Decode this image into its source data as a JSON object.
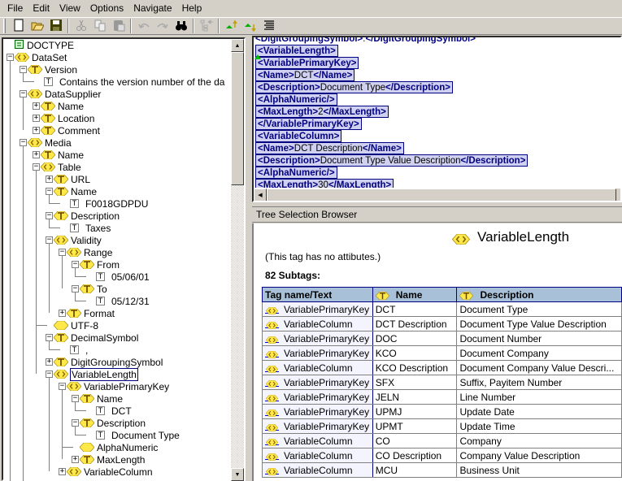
{
  "menu": [
    "File",
    "Edit",
    "View",
    "Options",
    "Navigate",
    "Help"
  ],
  "toolbar": {
    "buttons": [
      {
        "name": "new-icon",
        "enabled": true
      },
      {
        "name": "open-icon",
        "enabled": true
      },
      {
        "name": "save-icon",
        "enabled": true
      },
      {
        "name": "cut-icon",
        "enabled": false
      },
      {
        "name": "copy-icon",
        "enabled": false
      },
      {
        "name": "paste-icon",
        "enabled": false
      },
      {
        "name": "undo-icon",
        "enabled": false
      },
      {
        "name": "redo-icon",
        "enabled": false
      },
      {
        "name": "find-icon",
        "enabled": true
      },
      {
        "name": "tree-back-icon",
        "enabled": false
      },
      {
        "name": "move-up-icon",
        "enabled": true
      },
      {
        "name": "move-down-icon",
        "enabled": true
      },
      {
        "name": "format-icon",
        "enabled": true
      }
    ]
  },
  "tree": [
    {
      "depth": 0,
      "type": "doctype",
      "label": "DOCTYPE",
      "expander": "none"
    },
    {
      "depth": 0,
      "type": "element",
      "label": "DataSet",
      "expander": "minus"
    },
    {
      "depth": 1,
      "type": "text-element",
      "label": "Version",
      "expander": "minus"
    },
    {
      "depth": 2,
      "type": "text",
      "label": "Contains the version number of the da",
      "expander": "none"
    },
    {
      "depth": 1,
      "type": "element",
      "label": "DataSupplier",
      "expander": "minus"
    },
    {
      "depth": 2,
      "type": "text-element",
      "label": "Name",
      "expander": "plus"
    },
    {
      "depth": 2,
      "type": "text-element",
      "label": "Location",
      "expander": "plus"
    },
    {
      "depth": 2,
      "type": "text-element",
      "label": "Comment",
      "expander": "plus"
    },
    {
      "depth": 1,
      "type": "element",
      "label": "Media",
      "expander": "minus"
    },
    {
      "depth": 2,
      "type": "text-element",
      "label": "Name",
      "expander": "plus"
    },
    {
      "depth": 2,
      "type": "element",
      "label": "Table",
      "expander": "minus"
    },
    {
      "depth": 3,
      "type": "text-element",
      "label": "URL",
      "expander": "plus"
    },
    {
      "depth": 3,
      "type": "text-element",
      "label": "Name",
      "expander": "minus"
    },
    {
      "depth": 4,
      "type": "text",
      "label": "F0018GDPDU",
      "expander": "none"
    },
    {
      "depth": 3,
      "type": "text-element",
      "label": "Description",
      "expander": "minus"
    },
    {
      "depth": 4,
      "type": "text",
      "label": "Taxes",
      "expander": "none"
    },
    {
      "depth": 3,
      "type": "element",
      "label": "Validity",
      "expander": "minus"
    },
    {
      "depth": 4,
      "type": "element",
      "label": "Range",
      "expander": "minus"
    },
    {
      "depth": 5,
      "type": "text-element",
      "label": "From",
      "expander": "minus"
    },
    {
      "depth": 6,
      "type": "text",
      "label": "05/06/01",
      "expander": "none"
    },
    {
      "depth": 5,
      "type": "text-element",
      "label": "To",
      "expander": "minus"
    },
    {
      "depth": 6,
      "type": "text",
      "label": "05/12/31",
      "expander": "none"
    },
    {
      "depth": 4,
      "type": "text-element",
      "label": "Format",
      "expander": "plus"
    },
    {
      "depth": 3,
      "type": "empty-element",
      "label": "UTF-8",
      "expander": "none"
    },
    {
      "depth": 3,
      "type": "text-element",
      "label": "DecimalSymbol",
      "expander": "minus"
    },
    {
      "depth": 4,
      "type": "text",
      "label": ",",
      "expander": "none"
    },
    {
      "depth": 3,
      "type": "text-element",
      "label": "DigitGroupingSymbol",
      "expander": "plus"
    },
    {
      "depth": 3,
      "type": "element",
      "label": "VariableLength",
      "expander": "minus",
      "selected": true
    },
    {
      "depth": 4,
      "type": "element",
      "label": "VariablePrimaryKey",
      "expander": "minus"
    },
    {
      "depth": 5,
      "type": "text-element",
      "label": "Name",
      "expander": "minus"
    },
    {
      "depth": 6,
      "type": "text",
      "label": "DCT",
      "expander": "none"
    },
    {
      "depth": 5,
      "type": "text-element",
      "label": "Description",
      "expander": "minus"
    },
    {
      "depth": 6,
      "type": "text",
      "label": "Document Type",
      "expander": "none"
    },
    {
      "depth": 5,
      "type": "empty-element",
      "label": "AlphaNumeric",
      "expander": "none"
    },
    {
      "depth": 5,
      "type": "text-element",
      "label": "MaxLength",
      "expander": "plus"
    },
    {
      "depth": 4,
      "type": "element",
      "label": "VariableColumn",
      "expander": "plus"
    }
  ],
  "source": [
    {
      "open": "<DigitGroupingSymbol>",
      "text": ".",
      "close": "</DigitGroupingSymbol>",
      "highlight": false
    },
    {
      "open": "<VariableLength>",
      "text": "",
      "close": "",
      "highlight": true
    },
    {
      "open": "<VariablePrimaryKey>",
      "text": "",
      "close": "",
      "highlight": true
    },
    {
      "open": "<Name>",
      "text": "DCT",
      "close": "</Name>",
      "highlight": true
    },
    {
      "open": "<Description>",
      "text": "Document Type",
      "close": "</Description>",
      "highlight": true
    },
    {
      "open": "<AlphaNumeric/>",
      "text": "",
      "close": "",
      "highlight": true
    },
    {
      "open": "<MaxLength>",
      "text": "2",
      "close": "</MaxLength>",
      "highlight": true
    },
    {
      "open": "</VariablePrimaryKey>",
      "text": "",
      "close": "",
      "highlight": true
    },
    {
      "open": "<VariableColumn>",
      "text": "",
      "close": "",
      "highlight": true
    },
    {
      "open": "<Name>",
      "text": "DCT Description",
      "close": "</Name>",
      "highlight": true
    },
    {
      "open": "<Description>",
      "text": "Document Type Value Description",
      "close": "</Description>",
      "highlight": true
    },
    {
      "open": "<AlphaNumeric/>",
      "text": "",
      "close": "",
      "highlight": true
    },
    {
      "open": "<MaxLength>",
      "text": "30",
      "close": "</MaxLength>",
      "highlight": true
    }
  ],
  "browser": {
    "header": "Tree Selection Browser",
    "title": "VariableLength",
    "note": "(This tag has no attibutes.)",
    "subtags": "82 Subtags:",
    "columns": [
      "Tag name/Text",
      "Name",
      "Description"
    ],
    "rows": [
      [
        "VariablePrimaryKey",
        "DCT",
        "Document Type"
      ],
      [
        "VariableColumn",
        "DCT Description",
        "Document Type Value Description"
      ],
      [
        "VariablePrimaryKey",
        "DOC",
        "Document Number"
      ],
      [
        "VariablePrimaryKey",
        "KCO",
        "Document Company"
      ],
      [
        "VariableColumn",
        "KCO Description",
        "Document Company Value Descri..."
      ],
      [
        "VariablePrimaryKey",
        "SFX",
        "Suffix, Payitem Number"
      ],
      [
        "VariablePrimaryKey",
        "JELN",
        "Line Number"
      ],
      [
        "VariablePrimaryKey",
        "UPMJ",
        "Update Date"
      ],
      [
        "VariablePrimaryKey",
        "UPMT",
        "Update Time"
      ],
      [
        "VariableColumn",
        "CO",
        "Company"
      ],
      [
        "VariableColumn",
        "CO Description",
        "Company Value Description"
      ],
      [
        "VariableColumn",
        "MCU",
        "Business Unit"
      ]
    ]
  }
}
